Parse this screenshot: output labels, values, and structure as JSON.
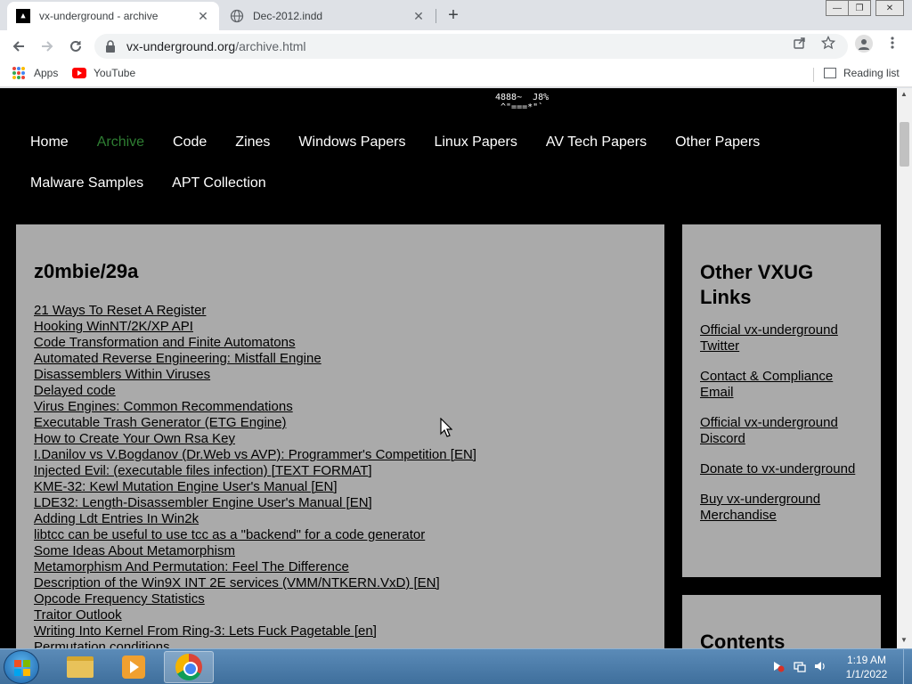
{
  "browser": {
    "tabs": [
      {
        "title": "vx-underground - archive",
        "favicon": "vx-underground-icon",
        "active": true
      },
      {
        "title": "Dec-2012.indd",
        "favicon": "globe-icon",
        "active": false
      }
    ],
    "url": {
      "host": "vx-underground.org",
      "path": "/archive.html"
    },
    "bookmarks": [
      {
        "label": "Apps",
        "icon": "apps-grid-icon"
      },
      {
        "label": "YouTube",
        "icon": "youtube-icon"
      }
    ],
    "reading_list": "Reading list"
  },
  "page": {
    "ascii_art": "4888~  J8%\n ^\"===*\"`",
    "nav": {
      "row1": [
        "Home",
        "Archive",
        "Code",
        "Zines",
        "Windows Papers",
        "Linux Papers",
        "AV Tech Papers",
        "Other Papers"
      ],
      "row2": [
        "Malware Samples",
        "APT Collection"
      ],
      "current": "Archive"
    },
    "main": {
      "heading": "z0mbie/29a",
      "links": [
        "21 Ways To Reset A Register",
        "Hooking WinNT/2K/XP API",
        "Code Transformation and Finite Automatons",
        "Automated Reverse Engineering: Mistfall Engine",
        "Disassemblers Within Viruses",
        "Delayed code",
        "Virus Engines: Common Recommendations",
        "Executable Trash Generator (ETG Engine)",
        "How to Create Your Own Rsa Key",
        "I.Danilov vs V.Bogdanov (Dr.Web vs AVP): Programmer's Competition [EN]",
        "Injected Evil: (executable files infection) [TEXT FORMAT]",
        "KME-32: Kewl Mutation Engine User's Manual [EN]",
        "LDE32: Length-Disassembler Engine User's Manual [EN]",
        "Adding Ldt Entries In Win2k",
        "libtcc can be useful to use tcc as a \"backend\" for a code generator",
        "Some Ideas About Metamorphism",
        "Metamorphism And Permutation: Feel The Difference",
        "Description of the Win9X INT 2E services (VMM/NTKERN.VxD) [EN]",
        "Opcode Frequency Statistics",
        "Traitor Outlook",
        "Writing Into Kernel From Ring-3: Lets Fuck Pagetable [en]",
        "Permutation conditions"
      ]
    },
    "sidebar": {
      "heading": "Other VXUG Links",
      "links": [
        "Official vx-underground Twitter",
        "Contact & Compliance Email",
        "Official vx-underground Discord",
        "Donate to vx-underground",
        "Buy vx-underground Merchandise"
      ]
    },
    "contents_heading": "Contents"
  },
  "taskbar": {
    "time": "1:19 AM",
    "date": "1/1/2022"
  }
}
